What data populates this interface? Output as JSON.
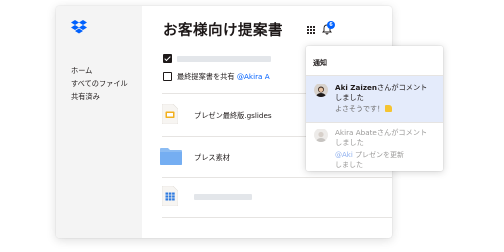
{
  "sidebar": {
    "logo": "dropbox-logo",
    "items": [
      {
        "label": "ホーム"
      },
      {
        "label": "すべてのファイル"
      },
      {
        "label": "共有済み"
      }
    ]
  },
  "main": {
    "title": "お客様向け提案書",
    "tasks": [
      {
        "checked": true,
        "text": ""
      },
      {
        "checked": false,
        "text": "最終提案書を共有",
        "mention": "@Akira A"
      }
    ],
    "files": [
      {
        "name": "プレゼン最終版.gslides",
        "icon": "slides-file-icon"
      },
      {
        "name": "プレス素材",
        "icon": "folder-icon"
      },
      {
        "name": "",
        "icon": "spreadsheet-file-icon"
      }
    ]
  },
  "toolbar": {
    "apps_icon": "grid-icon",
    "bell_icon": "bell-icon",
    "badge_count": "6"
  },
  "notifications": {
    "header": "通知",
    "items": [
      {
        "author": "Aki Zaizen",
        "action": "さんがコメント",
        "action2": "しました",
        "sub": "よさそうです！",
        "emoji": "thumbs-up",
        "highlighted": true
      },
      {
        "author": "Akira Abate",
        "action": "さんがコメント",
        "action2": "しました",
        "sub_mention": "@Aki",
        "sub": "プレゼンを更新",
        "sub2": "しました",
        "highlighted": false
      }
    ]
  },
  "colors": {
    "accent": "#0061fe",
    "highlight": "#e4ebfb",
    "sidebar_bg": "#f4f4f4",
    "folder": "#7ab3f5",
    "slides": "#f2b01e",
    "sheets": "#2f7be0"
  }
}
